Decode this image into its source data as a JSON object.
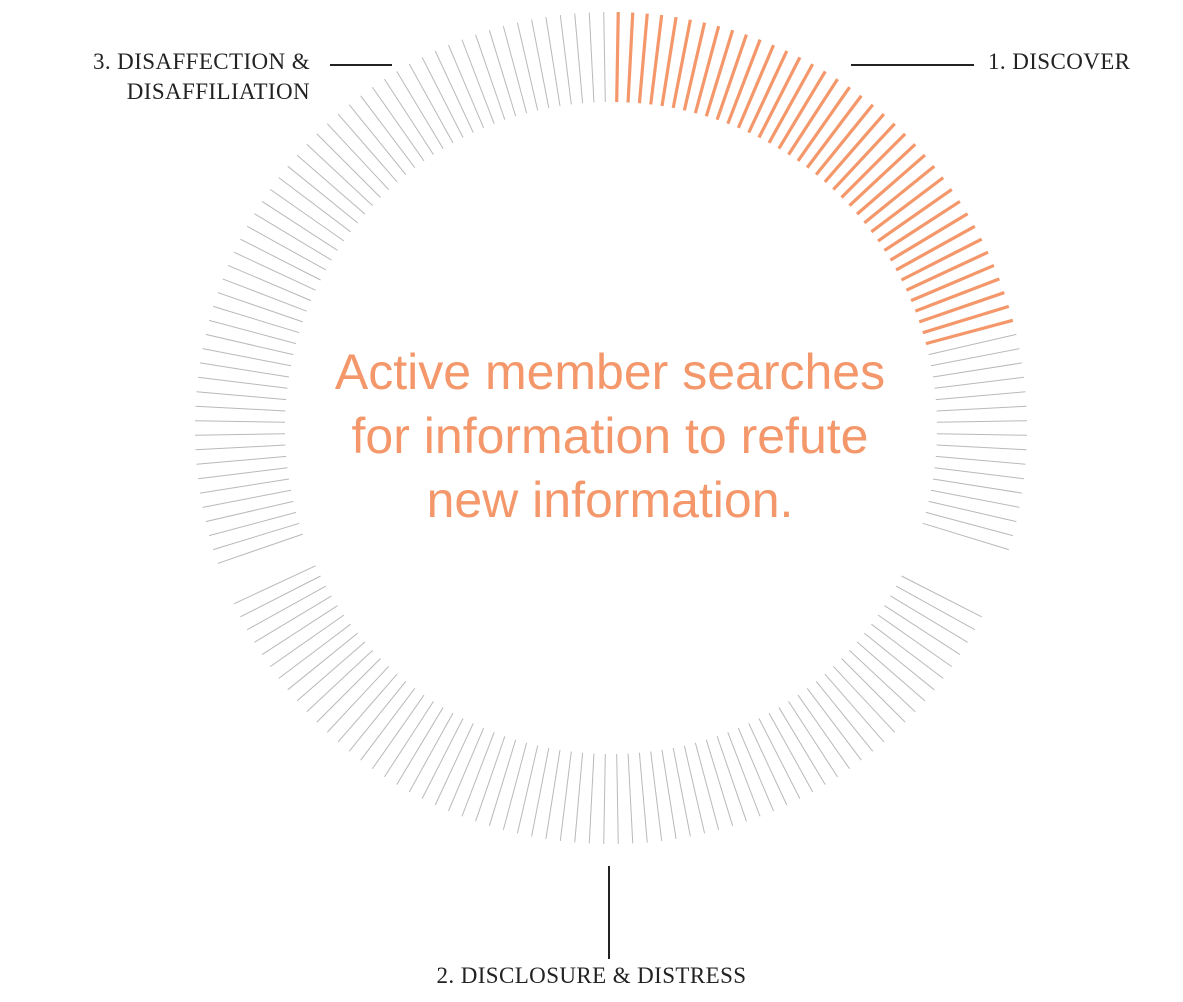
{
  "diagram": {
    "center_text": "Active member searches for information to refute new information.",
    "stages": {
      "discover": "1. DISCOVER",
      "disclosure": "2. DISCLOSURE & DISTRESS",
      "disaffection_line1": "3. DISAFFECTION &",
      "disaffection_line2": "DISAFFILIATION"
    },
    "progress": {
      "highlighted_fraction": 0.22,
      "highlighted_ticks": 38,
      "total_ticks": 180
    },
    "colors": {
      "accent": "#f4976a",
      "tick_inactive": "#b9b9b9",
      "text": "#222222",
      "background": "#ffffff"
    }
  }
}
